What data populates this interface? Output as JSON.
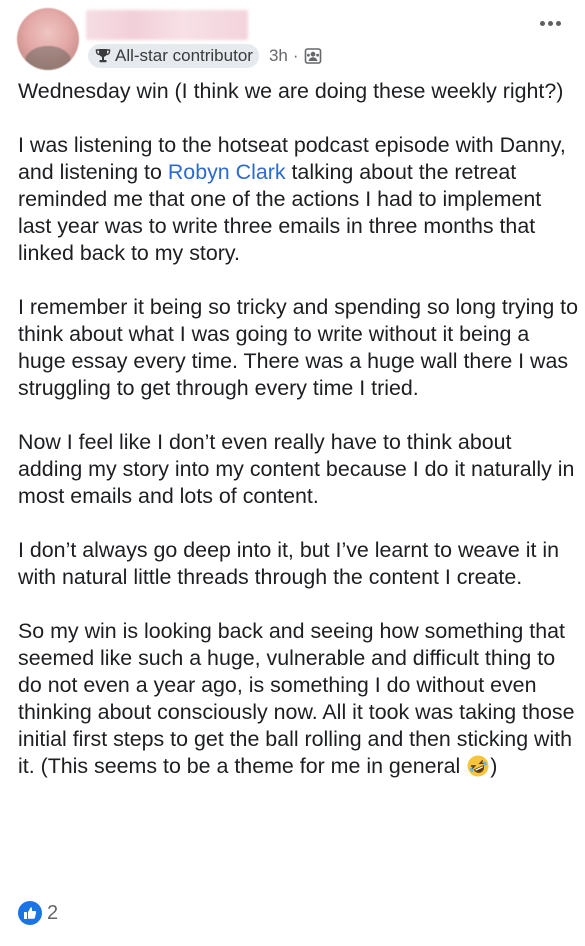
{
  "post": {
    "author_badge": "All-star contributor",
    "time": "3h",
    "separator": "·",
    "paragraph_1": "Wednesday win (I think we are doing these weekly right?)",
    "paragraph_2_before": "I was listening to the hotseat podcast episode with Danny, and listening to ",
    "mention": "Robyn Clark",
    "paragraph_2_after": " talking about the retreat reminded me that one of the actions I had to implement last year was to write three emails in three months that linked back to my story.",
    "paragraph_3": "I remember it being so tricky and spending so long trying to think about what I was going to write without it being a huge essay every time. There was a huge wall there I was struggling to get through every time I tried.",
    "paragraph_4": "Now I feel like I don’t even really have to think about adding my story into my content because I do it naturally in most emails and lots of content.",
    "paragraph_5": "I don’t always go deep into it, but I’ve learnt to weave it in with natural little threads through the content I create.",
    "paragraph_6": "So my win is looking back and seeing how something that seemed like such a huge, vulnerable and difficult thing to do not even a year ago, is something I do without even thinking about consciously now. All it took was taking those initial first steps to get the ball rolling and then sticking with it. (This seems to be a theme for me in general ",
    "paragraph_6_end": ")",
    "reaction_count": "2"
  },
  "icons": {
    "badge": "trophy-icon",
    "audience": "group-audience-icon",
    "menu": "more-options-icon",
    "emoji": "rolling-on-floor-laughing-emoji",
    "reaction": "like-reaction-icon"
  },
  "colors": {
    "mention": "#2d6ad0",
    "like": "#1b74e4",
    "badge_bg": "#e6e9ee",
    "meta_text": "#65676b"
  }
}
